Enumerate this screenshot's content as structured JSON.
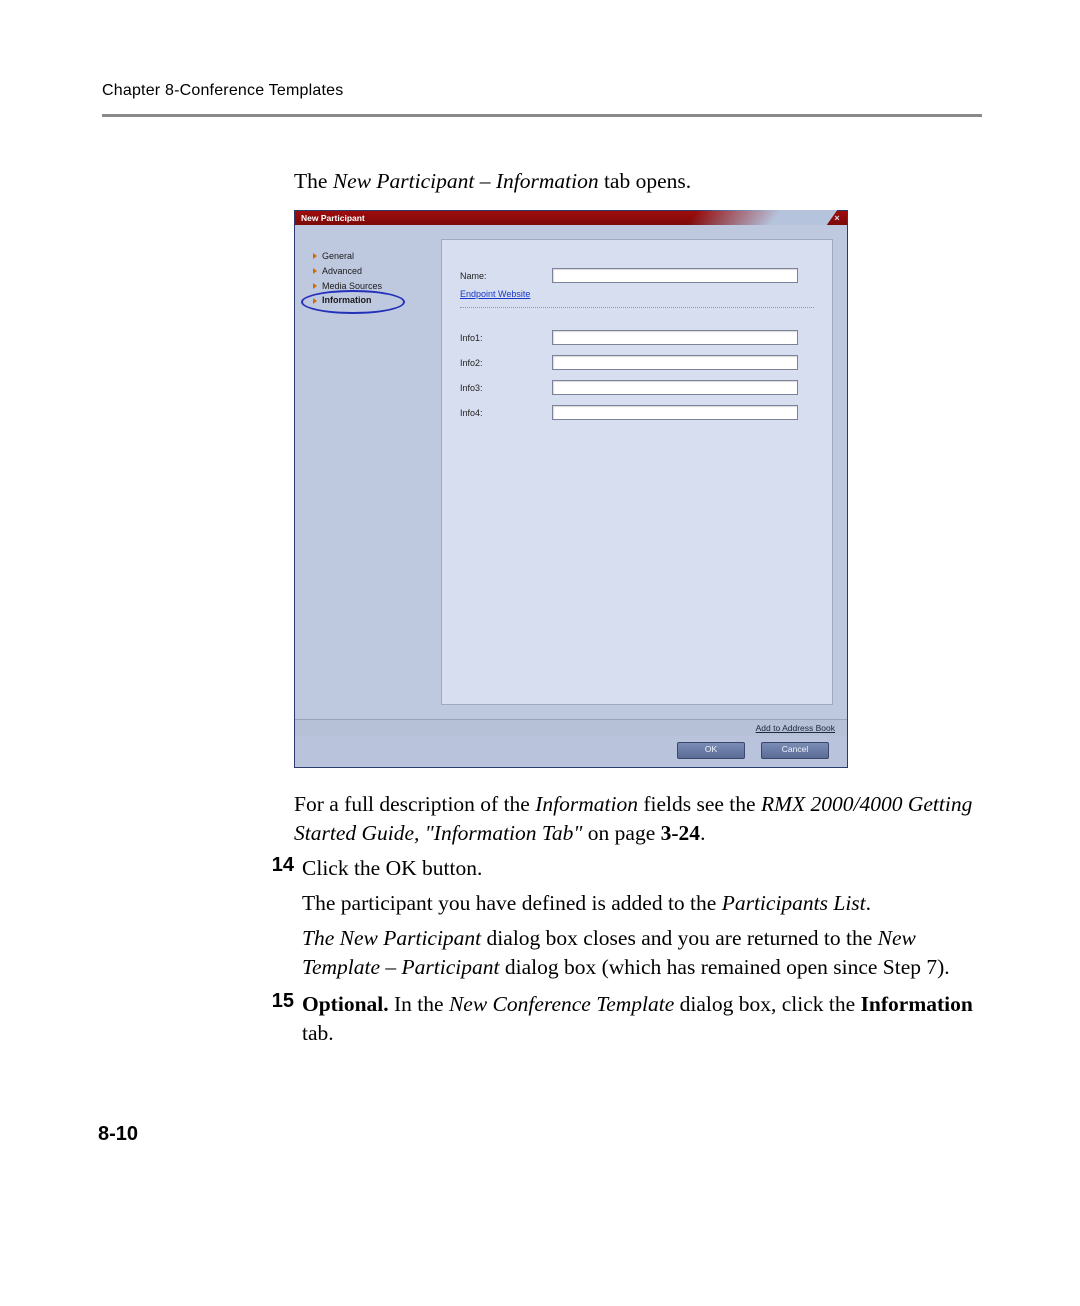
{
  "header": {
    "chapter": "Chapter 8-Conference Templates"
  },
  "intro": {
    "prefix": "The ",
    "italic": "New Participant – Information",
    "suffix": " tab opens."
  },
  "dialog": {
    "title": "New Participant",
    "close": "×",
    "sidebar": {
      "items": [
        {
          "label": "General"
        },
        {
          "label": "Advanced"
        },
        {
          "label": "Media Sources"
        },
        {
          "label": "Information"
        }
      ]
    },
    "form": {
      "name_label": "Name:",
      "name_value": "",
      "endpoint_link": "Endpoint Website",
      "info1_label": "Info1:",
      "info1_value": "",
      "info2_label": "Info2:",
      "info2_value": "",
      "info3_label": "Info3:",
      "info3_value": "",
      "info4_label": "Info4:",
      "info4_value": ""
    },
    "status_link": "Add to Address Book",
    "buttons": {
      "ok": "OK",
      "cancel": "Cancel"
    }
  },
  "post": {
    "p1a": "For a full description of the ",
    "p1b": "Information",
    "p1c": " fields see the ",
    "p1d": "RMX 2000/4000 Getting Started Guide, \"Information Tab\"",
    "p1e": " on page ",
    "p1f": "3-24",
    "p1g": "."
  },
  "step14": {
    "num": "14",
    "line1": "Click the OK button.",
    "line2a": "The participant you have defined is added to the ",
    "line2b": "Participants List",
    "line2c": ".",
    "line3a": "The New Participant",
    "line3b": " dialog box closes and you are returned to the ",
    "line3c": "New Template – Participant",
    "line3d": " dialog box (which has remained open since Step 7)."
  },
  "step15": {
    "num": "15",
    "bold": "Optional.",
    "a": " In the ",
    "b": "New Conference Template",
    "c": " dialog box, click the ",
    "d": "Information",
    "e": " tab."
  },
  "page_number": "8-10"
}
